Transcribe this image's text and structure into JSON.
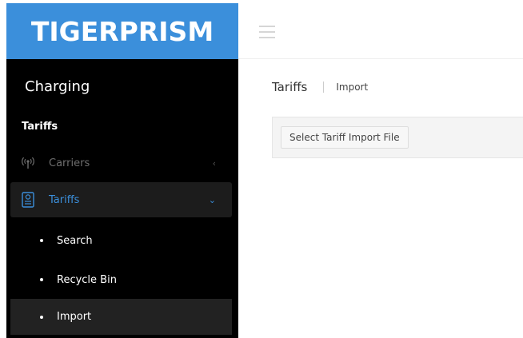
{
  "brand": {
    "logo_text": "TIGERPRISM",
    "color": "#3b8fdb"
  },
  "topbar": {
    "menu_icon": "hamburger-icon"
  },
  "sidebar": {
    "title": "Charging",
    "section_label": "Tariffs",
    "items": [
      {
        "label": "Carriers",
        "icon": "antenna-icon",
        "chevron": "‹",
        "active": false
      },
      {
        "label": "Tariffs",
        "icon": "document-icon",
        "chevron": "⌄",
        "active": true
      }
    ],
    "subitems": [
      {
        "label": "Search",
        "active": false
      },
      {
        "label": "Recycle Bin",
        "active": false
      },
      {
        "label": "Import",
        "active": true
      }
    ]
  },
  "breadcrumb": {
    "root": "Tariffs",
    "current": "Import"
  },
  "main": {
    "import_button_label": "Select Tariff Import File"
  },
  "colors": {
    "accent": "#3b8fdb",
    "sidebar_bg": "#000000",
    "active_item_bg": "#1c1c1c"
  }
}
